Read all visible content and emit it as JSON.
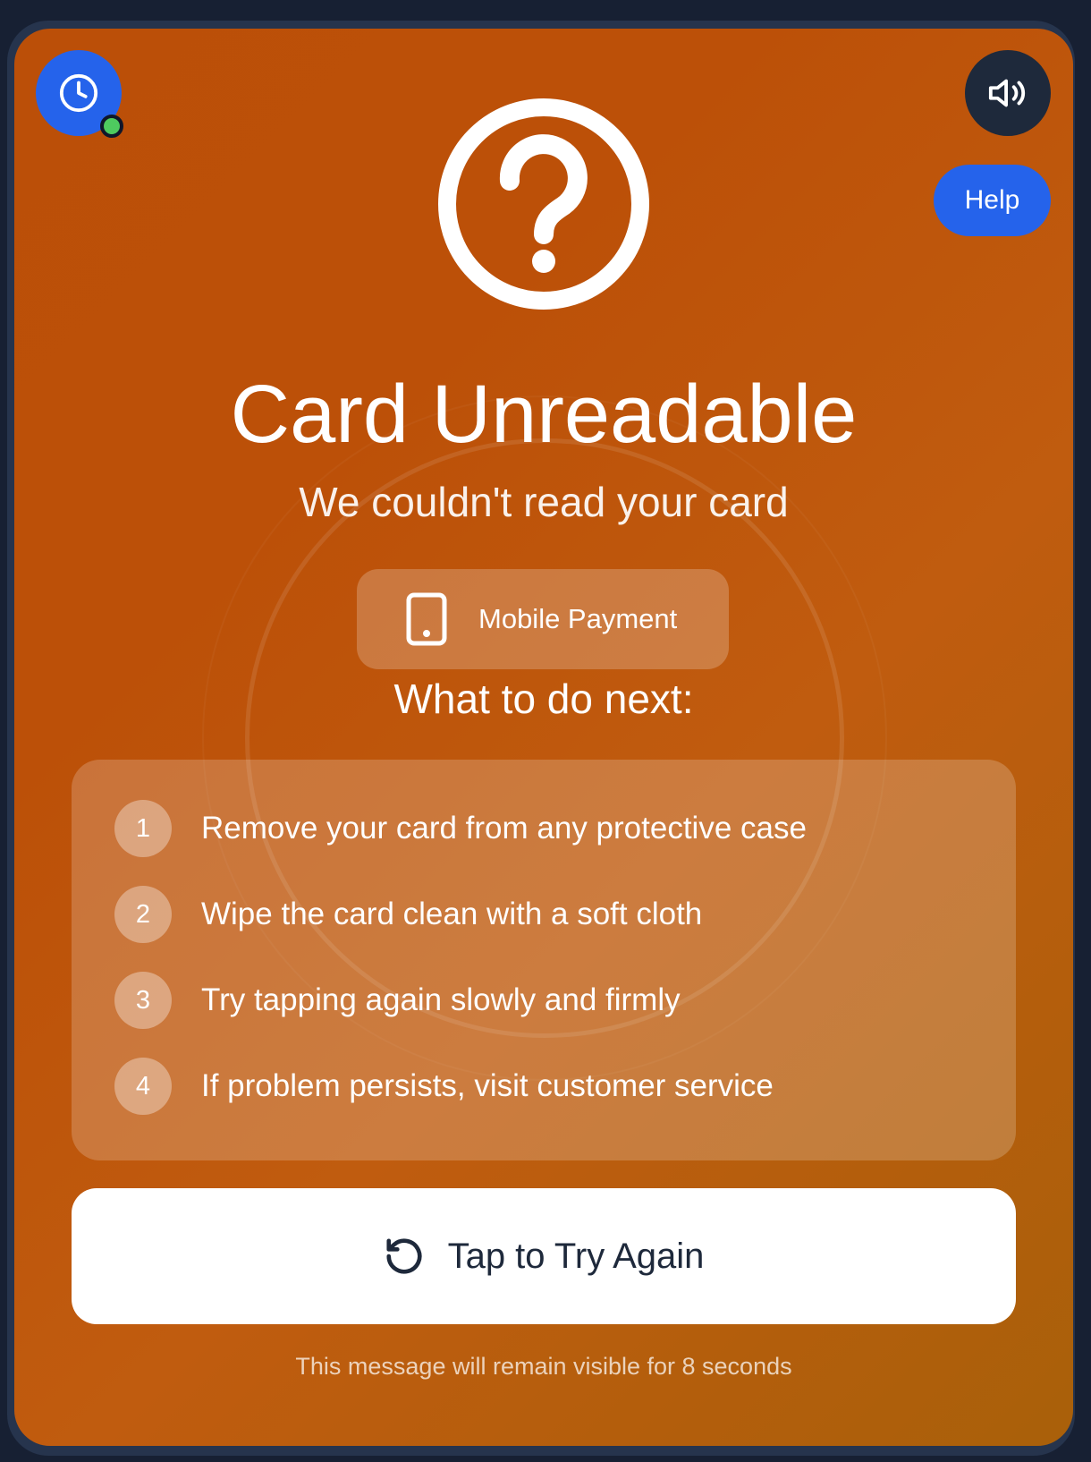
{
  "screen": {
    "title": "Card Unreadable",
    "subtitle": "We couldn't read your card",
    "footer_note": "This message will remain visible for 8 seconds"
  },
  "header": {
    "help_label": "Help",
    "clock_icon": "clock-icon",
    "sound_icon": "speaker-icon",
    "status_color": "#4ecb5f"
  },
  "payment_method": {
    "label": "Mobile Payment",
    "icon": "phone-icon"
  },
  "next_steps": {
    "heading": "What to do next:",
    "items": [
      {
        "num": "1",
        "text": "Remove your card from any protective case"
      },
      {
        "num": "2",
        "text": "Wipe the card clean with a soft cloth"
      },
      {
        "num": "3",
        "text": "Try tapping again slowly and firmly"
      },
      {
        "num": "4",
        "text": "If problem persists, visit customer service"
      }
    ]
  },
  "actions": {
    "retry_label": "Tap to Try Again",
    "retry_icon": "refresh-icon"
  },
  "colors": {
    "background_accent": "#bb4f08",
    "primary_blue": "#2563eb",
    "dark": "#1e293b"
  }
}
